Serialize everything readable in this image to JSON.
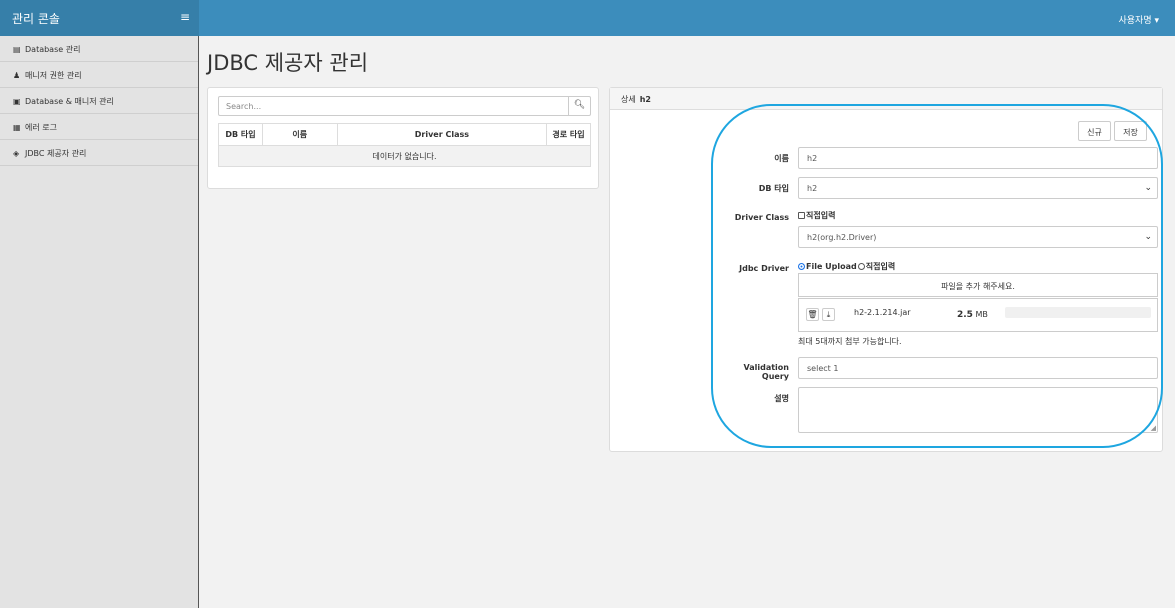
{
  "header": {
    "app_title": "관리 콘솔",
    "menu_icon": "hamburger-icon",
    "user_label": "사용자명 ▾"
  },
  "sidebar": {
    "items": [
      {
        "icon": "database-icon",
        "glyph": "▤",
        "label": "Database 관리"
      },
      {
        "icon": "user-lock-icon",
        "glyph": "♟",
        "label": "매니저 권한 관리"
      },
      {
        "icon": "id-card-icon",
        "glyph": "▣",
        "label": "Database & 매니저 관리"
      },
      {
        "icon": "list-icon",
        "glyph": "▦",
        "label": "에러 로그"
      },
      {
        "icon": "plug-icon",
        "glyph": "◈",
        "label": "JDBC 제공자 관리"
      }
    ]
  },
  "page": {
    "title": "JDBC 제공자 관리"
  },
  "list_panel": {
    "search_placeholder": "Search...",
    "search_icon": "search-icon",
    "columns": [
      "DB 타입",
      "이름",
      "Driver Class",
      "경로 타입"
    ],
    "empty_message": "데이터가 없습니다."
  },
  "detail_panel": {
    "header_label": "상세",
    "header_name": "h2",
    "new_button": "신규",
    "save_button": "저장",
    "name_label": "이름",
    "name_value": "h2",
    "db_type_label": "DB 타입",
    "db_type_value": "h2",
    "driver_class_label": "Driver Class",
    "driver_direct_label": "직접입력",
    "driver_class_value": "h2(org.h2.Driver)",
    "jdbc_driver_label": "Jdbc Driver",
    "file_upload_label": "File Upload",
    "jdbc_direct_label": "직접입력",
    "upload_prompt": "파일을 추가 해주세요.",
    "file_name": "h2-2.1.214.jar",
    "file_size_num": "2.5",
    "file_size_unit": "MB",
    "upload_progress": 0,
    "upload_note": "최대 5대까지 첨부 가능합니다.",
    "validation_label": "Validation Query",
    "validation_value": "select 1",
    "desc_label": "설명",
    "desc_value": ""
  },
  "colors": {
    "topbar": "#3c8dbc",
    "brand": "#367fa9",
    "highlight": "#1ea6e0"
  }
}
